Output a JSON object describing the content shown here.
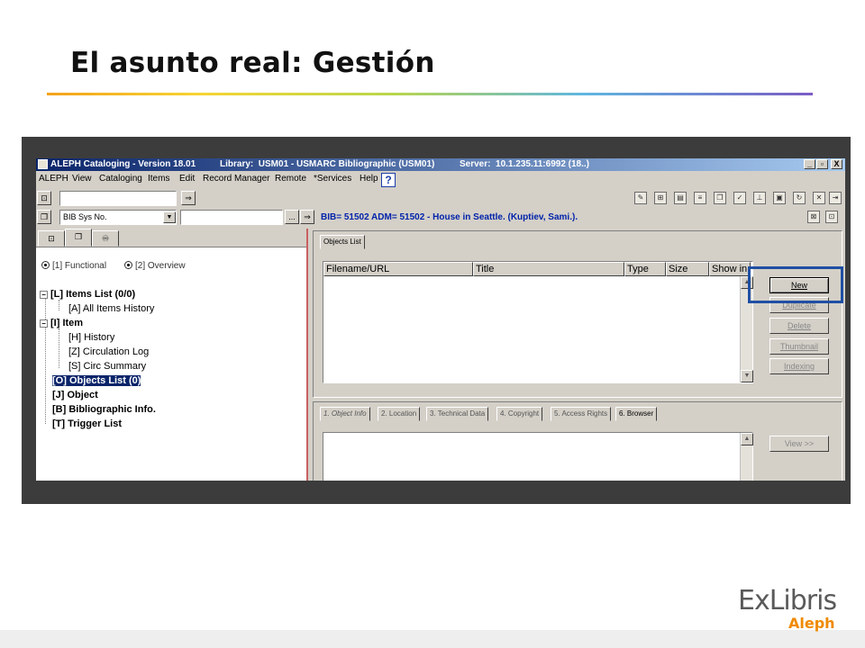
{
  "slide": {
    "title": "El asunto real: Gestión",
    "logo_main": "ExLibris",
    "logo_sub": "Aleph"
  },
  "window": {
    "title_app": "ALEPH Cataloging - Version 18.01",
    "title_library": "Library:  USM01 - USMARC Bibliographic (USM01)",
    "title_server": "Server:  10.1.235.11:6992 (18..)",
    "controls": [
      "_",
      "▫",
      "X"
    ]
  },
  "menu": {
    "items": [
      "ALEPH",
      "View",
      "Cataloging",
      "Items",
      "Edit",
      "Record Manager",
      "Remote",
      "*Services",
      "Help"
    ],
    "help_icon": "?"
  },
  "toolbar": {
    "search_value": "",
    "index_select": "BIB Sys No.",
    "index_value": "",
    "ellipsis": "...",
    "record_info": "BIB= 51502  ADM= 51502 - House in Seattle. (Kuptiev, Sami.)."
  },
  "left_panel": {
    "radio_functional": "[1] Functional",
    "radio_overview": "[2] Overview",
    "tree": [
      {
        "label": "[L] Items List (0/0)",
        "bold": true
      },
      {
        "label": "[A] All Items History",
        "bold": false
      },
      {
        "label": "[I] Item",
        "bold": true
      },
      {
        "label": "[H] History",
        "bold": false
      },
      {
        "label": "[Z] Circulation Log",
        "bold": false
      },
      {
        "label": "[S] Circ Summary",
        "bold": false
      },
      {
        "label": "[O] Objects List (0)",
        "bold": true,
        "selected": true
      },
      {
        "label": "[J] Object",
        "bold": true
      },
      {
        "label": "[B] Bibliographic Info.",
        "bold": true
      },
      {
        "label": "[T] Trigger List",
        "bold": true
      }
    ]
  },
  "objects_list": {
    "tab": "Objects List",
    "columns": [
      "Filename/URL",
      "Title",
      "Type",
      "Size",
      "Show in"
    ],
    "buttons": {
      "new": "New",
      "duplicate": "Duplicate",
      "delete": "Delete",
      "thumbnail": "Thumbnail",
      "indexing": "Indexing"
    }
  },
  "object_detail": {
    "tabs": [
      "1. Object Info",
      "2. Location",
      "3. Technical Data",
      "4. Copyright",
      "5. Access Rights",
      "6. Browser"
    ],
    "view_button": "View >>"
  },
  "colors": {
    "title_rule": [
      "#f4a21a",
      "#f6d531",
      "#b9d64a",
      "#5fb6e0",
      "#7a5cc4"
    ],
    "highlight": "#1f4fa3",
    "record_text": "#0022aa",
    "logo_accent": "#f08a00"
  }
}
